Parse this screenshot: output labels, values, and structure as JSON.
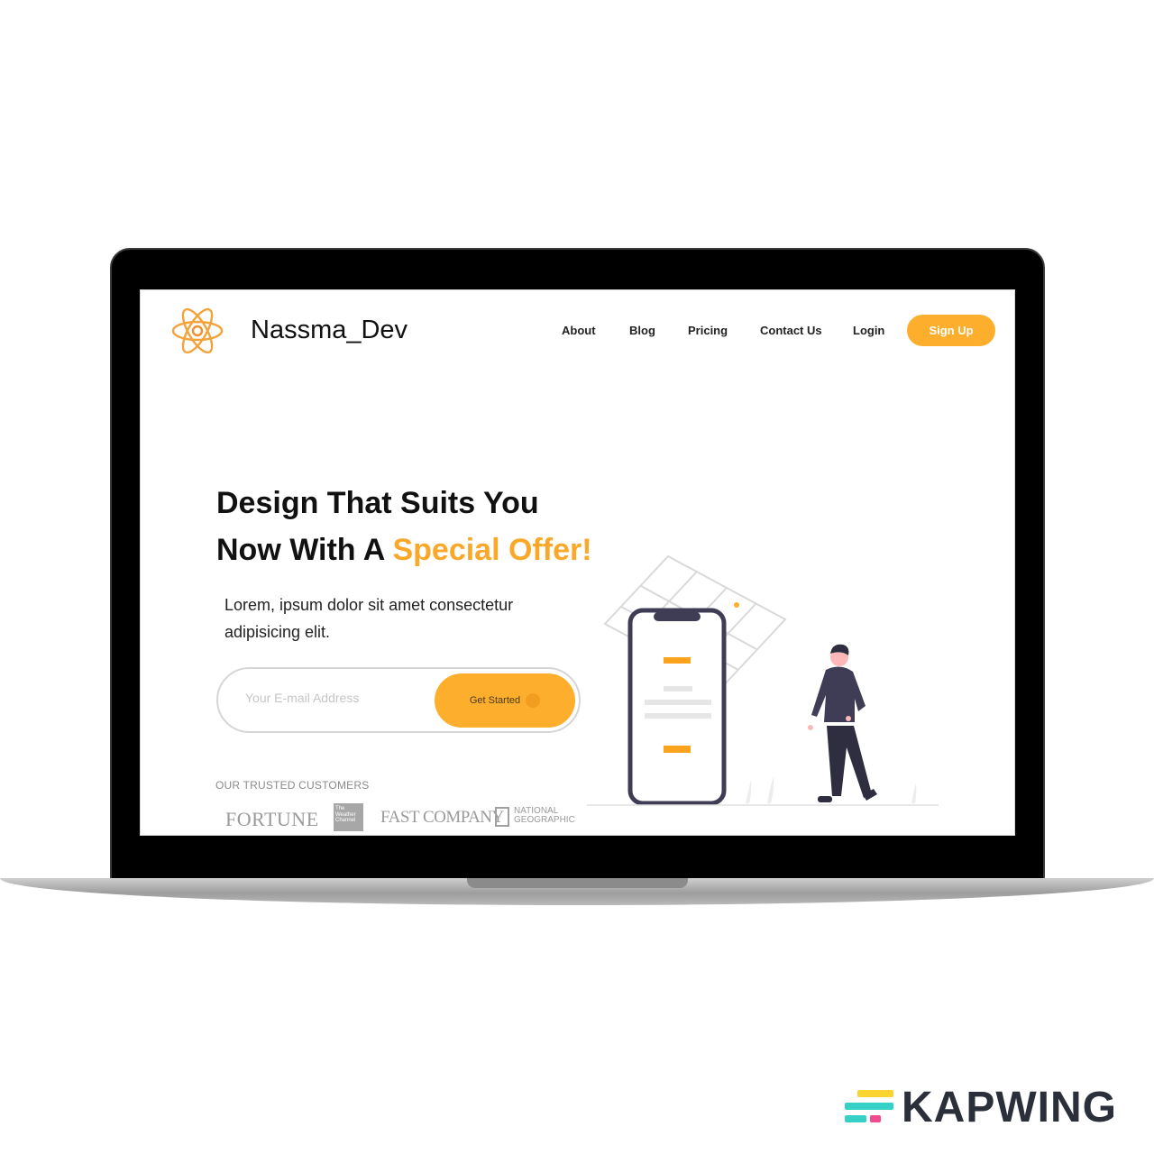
{
  "brand": {
    "name": "Nassma_Dev",
    "logo_icon": "atom-icon"
  },
  "nav": {
    "links": [
      "About",
      "Blog",
      "Pricing",
      "Contact Us",
      "Login"
    ],
    "signup_label": "Sign Up"
  },
  "hero": {
    "headline_line1": "Design That Suits You",
    "headline_line2_start": "Now With A ",
    "headline_line2_accent": "Special Offer!",
    "subtext": "Lorem, ipsum dolor sit amet consectetur adipisicing elit.",
    "email_placeholder": "Your E-mail Address",
    "cta_label": "Get Started"
  },
  "customers": {
    "heading": "OUR TRUSTED CUSTOMERS",
    "logos": {
      "fortune": "FORTUNE",
      "weather_1": "The",
      "weather_2": "Weather",
      "weather_3": "Channel",
      "fastco": "FAST COMPANY",
      "natgeo_1": "NATIONAL",
      "natgeo_2": "GEOGRAPHIC"
    }
  },
  "watermark": "KAPWING",
  "colors": {
    "accent": "#fcae2c",
    "text": "#111111",
    "device": "#3f3d56"
  }
}
